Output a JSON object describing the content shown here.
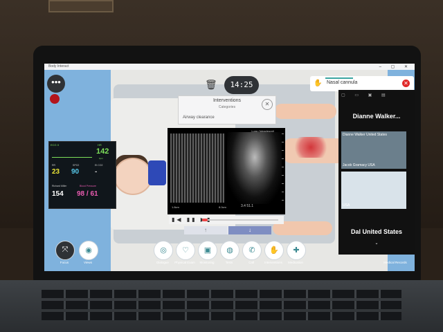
{
  "window": {
    "title": "Body Interact",
    "controls": "– ▢ ✕"
  },
  "header": {
    "menu_icon": "•••",
    "timer": "14:25 ❚❚"
  },
  "toast": {
    "label": "Nasal cannula",
    "close": "✕"
  },
  "modal": {
    "title": "Interventions",
    "subtitle": "Categories",
    "item": "Airway clearance",
    "close": "✕"
  },
  "echo": {
    "label": "Lung (Intrapleural)",
    "footer_left": "1.8cm",
    "footer_mid": "8.0cm",
    "footer_right": "3.4 51.1"
  },
  "player": {
    "controls": "▮◀ ▮▮ ▶▮",
    "up": "↑",
    "down": "↓"
  },
  "monitor": {
    "ecg": "ECG II",
    "hr_label": "HR",
    "hr": "142",
    "hr_unit": "bpm",
    "rr_label": "RR",
    "rr": "23",
    "spo2_label": "SPO2",
    "spo2": "90",
    "etco2_label": "Et CO2",
    "etco2": "-",
    "hb_label": "Richard Miller",
    "hb": "154",
    "bp_label": "Blood Pressure",
    "bp": "98 / 61"
  },
  "toolbar": {
    "items": [
      {
        "label": "Dialogue",
        "icon": "◎"
      },
      {
        "label": "Physical Exam",
        "icon": "♡"
      },
      {
        "label": "Monitoring",
        "icon": "▣"
      },
      {
        "label": "Tests",
        "icon": "◍"
      },
      {
        "label": "Call",
        "icon": "✆"
      },
      {
        "label": "Interventions",
        "icon": "✋"
      },
      {
        "label": "Medication",
        "icon": "✚"
      }
    ],
    "focus": "Focus",
    "views": "Views",
    "records": "Medical Records"
  },
  "video": {
    "icons": "▢ ▭ ▣ ▤",
    "name1": "Dianne Walker...",
    "tile1": "Dianne Walker United States",
    "tile2": "Jacob Gramacy USA",
    "tile3": "USA",
    "name2": "Dal United States",
    "more": "⌄"
  },
  "colors": {
    "accent": "#3c8a92",
    "alarm": "#e02828",
    "monitor_green": "#7ee05a",
    "bp_pink": "#e95bb0"
  }
}
